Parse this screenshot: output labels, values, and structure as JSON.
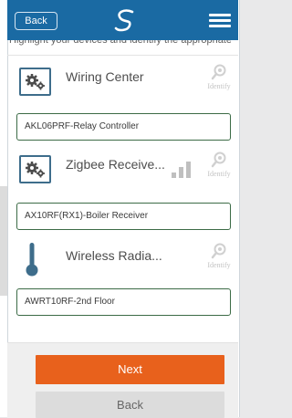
{
  "header": {
    "back_label": "Back"
  },
  "clipped_caption": "Highlight your devices and identify the appropriate",
  "devices": [
    {
      "name": "Wiring Center",
      "value": "AKL06PRF-Relay Controller",
      "identify_label": "Identify",
      "icon": "gear-module-icon"
    },
    {
      "name": "Zigbee Receive...",
      "value": "AX10RF(RX1)-Boiler Receiver",
      "identify_label": "Identify",
      "icon": "gear-module-icon",
      "signal_bars": 3
    },
    {
      "name": "Wireless Radia...",
      "value": "AWRT10RF-2nd Floor",
      "identify_label": "Identify",
      "icon": "thermometer-icon"
    }
  ],
  "footer": {
    "next_label": "Next",
    "back_label": "Back"
  },
  "colors": {
    "header": "#1a6aa3",
    "primary_button": "#e8611c",
    "field_border": "#3c6b46",
    "icon_stroke": "#3e6d8b"
  }
}
